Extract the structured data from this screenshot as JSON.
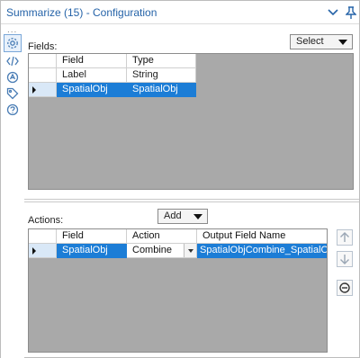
{
  "window": {
    "title": "Summarize (15) - Configuration"
  },
  "toolstrip": {
    "dots": "...",
    "tools": [
      {
        "name": "configuration",
        "icon": "gear-icon",
        "active": true
      },
      {
        "name": "xml-view",
        "icon": "code-icon",
        "active": false
      },
      {
        "name": "annotation",
        "icon": "annotation-icon",
        "active": false
      },
      {
        "name": "tags",
        "icon": "tag-icon",
        "active": false
      },
      {
        "name": "help",
        "icon": "help-icon",
        "active": false
      }
    ]
  },
  "fields_section": {
    "label": "Fields:",
    "select_dropdown": "Select",
    "columns": [
      "Field",
      "Type"
    ],
    "rows": [
      {
        "field": "Label",
        "type": "String",
        "selected": false
      },
      {
        "field": "SpatialObj",
        "type": "SpatialObj",
        "selected": true
      }
    ]
  },
  "actions_section": {
    "label": "Actions:",
    "add_dropdown": "Add",
    "columns": [
      "Field",
      "Action",
      "Output Field Name"
    ],
    "rows": [
      {
        "field": "SpatialObj",
        "action": "Combine",
        "output": "SpatialObjCombine_SpatialObj",
        "selected": true
      }
    ]
  },
  "side_buttons": [
    {
      "name": "move-up",
      "icon": "arrow-up-icon",
      "enabled": false
    },
    {
      "name": "move-down",
      "icon": "arrow-down-icon",
      "enabled": false
    },
    {
      "name": "remove",
      "icon": "minus-circle-icon",
      "enabled": true
    }
  ],
  "colors": {
    "title": "#2563a8",
    "selection": "#1c7dd6",
    "grid_background": "#a9a9a9"
  }
}
